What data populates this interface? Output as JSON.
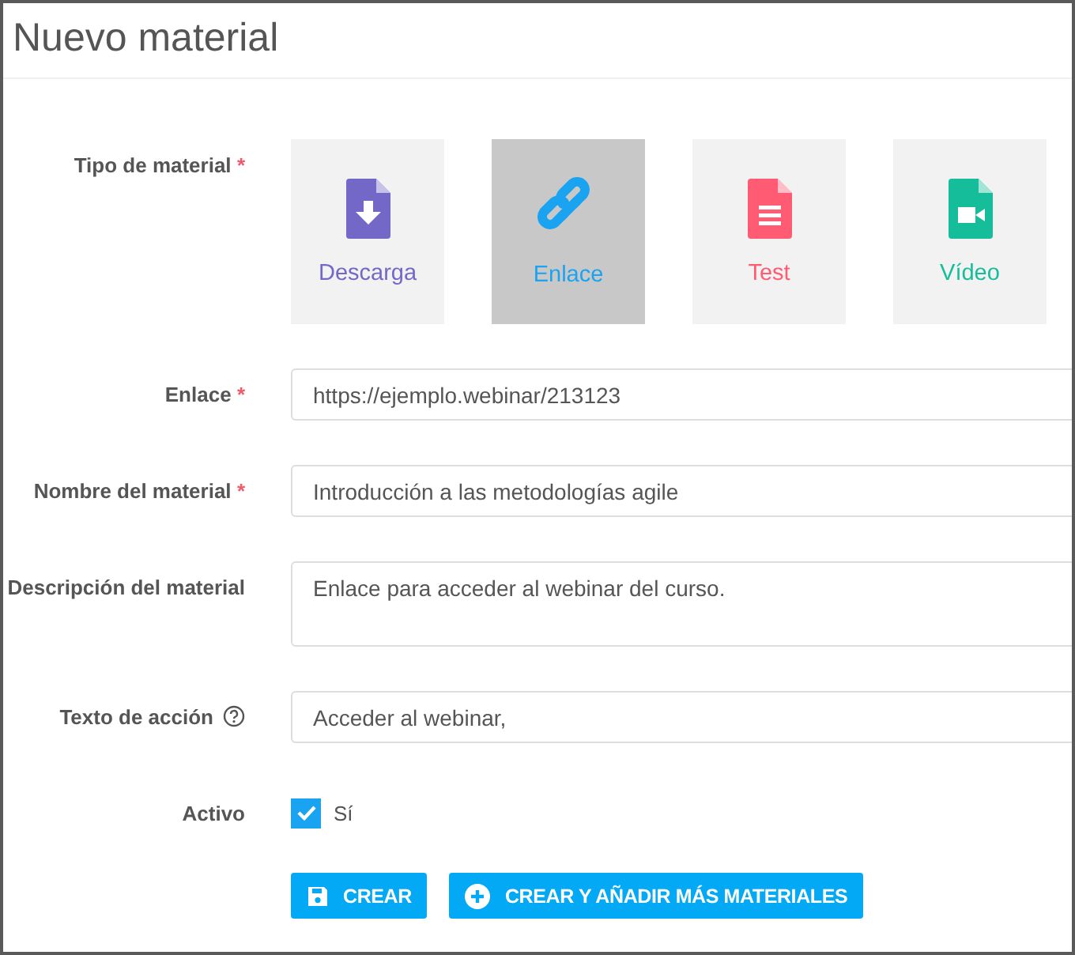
{
  "window": {
    "title": "Nuevo material"
  },
  "material_type": {
    "label": "Tipo de material",
    "mark": "*",
    "options": [
      {
        "label": "Descarga",
        "kind": "download",
        "color": "#7367c8",
        "selected": false
      },
      {
        "label": "Enlace",
        "kind": "link",
        "color": "#1aa3f0",
        "selected": true
      },
      {
        "label": "Test",
        "kind": "test",
        "color": "#ff5c73",
        "selected": false
      },
      {
        "label": "Vídeo",
        "kind": "video",
        "color": "#16bd9a",
        "selected": false
      }
    ]
  },
  "fields": [
    {
      "label": "Enlace",
      "mark": "*",
      "kind": "text",
      "value": "https://ejemplo.webinar/213123"
    },
    {
      "label": "Nombre del material",
      "mark": "*",
      "kind": "text",
      "value": "Introducción a las metodologías agile"
    },
    {
      "label": "Descripción del material",
      "kind": "textarea",
      "value": "Enlace para acceder al webinar del curso."
    },
    {
      "label": "Texto de acción",
      "kind": "text",
      "help": true,
      "value": "Acceder al webinar,"
    }
  ],
  "active": {
    "label": "Activo",
    "option": "Sí",
    "checked": true
  },
  "buttons": [
    {
      "label": "CREAR",
      "kind": "save"
    },
    {
      "label": "CREAR Y AÑADIR MÁS MATERIALES",
      "kind": "add"
    }
  ]
}
